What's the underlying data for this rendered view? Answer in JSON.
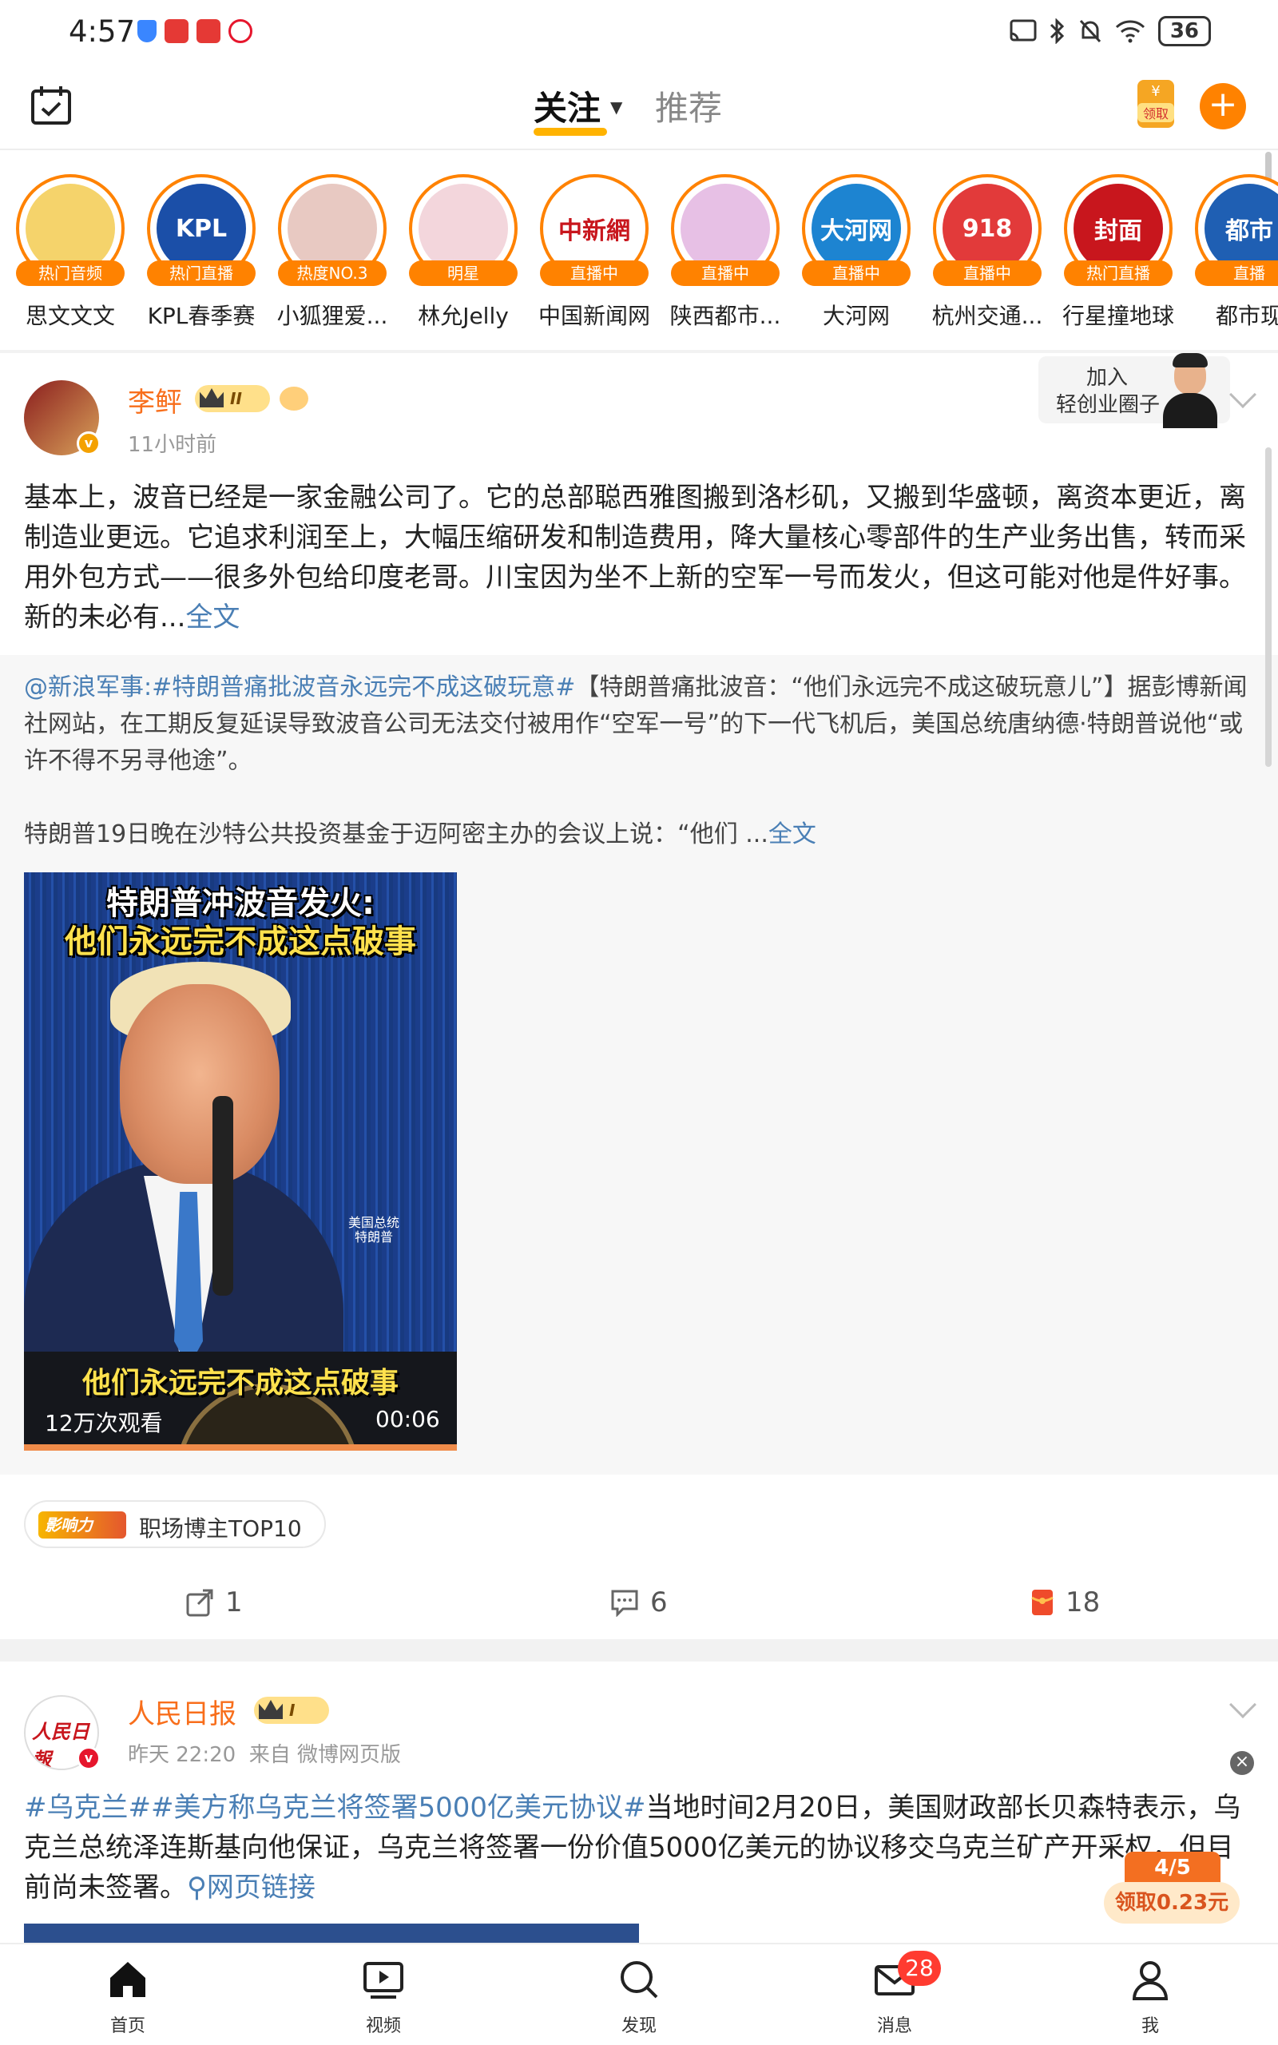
{
  "status_bar": {
    "time": "4:57",
    "battery": "36"
  },
  "top_nav": {
    "tabs": [
      {
        "label": "关注",
        "active": true
      },
      {
        "label": "推荐",
        "active": false
      }
    ],
    "redpacket_label": "领取",
    "redpacket_symbol": "¥",
    "plus_symbol": "+"
  },
  "avatars": [
    {
      "name": "思文文文",
      "badge": "热门音频",
      "icon": "sketch-portrait-avatar",
      "color": "#f5d36b"
    },
    {
      "name": "KPL春季赛",
      "badge": "热门直播",
      "icon": "kpl-logo",
      "logo_text": "KPL",
      "color": "#1b4fa8"
    },
    {
      "name": "小狐狸爱...",
      "badge": "热度NO.3",
      "icon": "girl-photo-avatar",
      "color": "#e8c9c2"
    },
    {
      "name": "林允Jelly",
      "badge": "明星",
      "icon": "star-photo-avatar",
      "color": "#f3d6dc"
    },
    {
      "name": "中国新闻网",
      "badge": "直播中",
      "icon": "chinanews-logo",
      "logo_text": "中新網",
      "color": "#ffffff"
    },
    {
      "name": "陕西都市...",
      "badge": "直播中",
      "icon": "group-photo-avatar",
      "color": "#e7c0e5"
    },
    {
      "name": "大河网",
      "badge": "直播中",
      "icon": "dahe-logo",
      "logo_text": "大河网",
      "color": "#1d84d1"
    },
    {
      "name": "杭州交通...",
      "badge": "直播中",
      "icon": "traffic-918-logo",
      "logo_text": "918",
      "color": "#e23a3a"
    },
    {
      "name": "行星撞地球",
      "badge": "热门直播",
      "icon": "fengmian-logo",
      "logo_text": "封面",
      "color": "#c8161d"
    },
    {
      "name": "都市现",
      "badge": "直播",
      "icon": "city-tv-logo",
      "logo_text": "都市",
      "color": "#1f5fb3"
    }
  ],
  "post1": {
    "author": "李鲆",
    "level": "II",
    "time": "11小时前",
    "join_circle": {
      "line1": "加入",
      "line2": "轻创业圈子"
    },
    "text": "基本上，波音已经是一家金融公司了。它的总部聪西雅图搬到洛杉矶，又搬到华盛顿，离资本更近，离制造业更远。它追求利润至上，大幅压缩研发和制造费用，降大量核心零部件的生产业务出售，转而采用外包方式——很多外包给印度老哥。川宝因为坐不上新的空军一号而发火，但这可能对他是件好事。新的未必有...",
    "more": "全文",
    "repost": {
      "mention": "@新浪军事",
      "topic": ":#特朗普痛批波音永远完不成这破玩意#",
      "text": "【特朗普痛批波音：“他们永远完不成这破玩意儿”】据彭博新闻社网站，在工期反复延误导致波音公司无法交付被用作“空军一号”的下一代飞机后，美国总统唐纳德·特朗普说他“或许不得不另寻他途”。",
      "text2": "特朗普19日晚在沙特公共投资基金于迈阿密主办的会议上说：“他们 ...",
      "more": "全文",
      "video": {
        "title_line1": "特朗普冲波音发火:",
        "title_line2": "他们永远完不成这点破事",
        "caption": "他们永远完不成这点破事",
        "small_label_1": "美国总统",
        "small_label_2": "特朗普",
        "views": "12万次观看",
        "duration": "00:06"
      }
    },
    "influence": {
      "badge": "影响力",
      "label": "职场博主TOP10"
    },
    "actions": {
      "repost": "1",
      "comment": "6",
      "like": "18"
    }
  },
  "post2": {
    "author": "人民日报",
    "logo_text": "人民日報",
    "level": "I",
    "time": "昨天 22:20",
    "source": "来自 微博网页版",
    "topic1": "#乌克兰#",
    "topic2": "#美方称乌克兰将签署5000亿美元协议#",
    "text": "当地时间2月20日，美国财政部长贝森特表示，乌克兰总统泽连斯基向他保证，乌克兰将签署一份价值5000亿美元的协议移交乌克兰矿产开采权，但目前尚未签署。",
    "link": "网页链接",
    "close": "×",
    "reward": {
      "progress": "4/5",
      "label": "领取0.23元"
    }
  },
  "bottom_nav": {
    "items": [
      {
        "label": "首页",
        "icon": "home-icon"
      },
      {
        "label": "视频",
        "icon": "video-icon"
      },
      {
        "label": "发现",
        "icon": "search-icon"
      },
      {
        "label": "消息",
        "icon": "message-icon",
        "badge": "28"
      },
      {
        "label": "我",
        "icon": "profile-icon"
      }
    ]
  },
  "colors": {
    "accent": "#ff8200",
    "name": "#f86e1b",
    "link": "#4a7fb5"
  }
}
